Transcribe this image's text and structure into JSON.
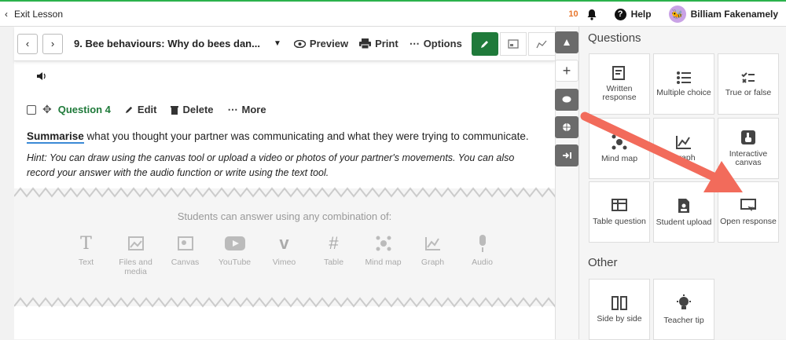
{
  "topbar": {
    "exit_label": "Exit Lesson",
    "notification_count": "10",
    "help_label": "Help",
    "user_name": "Billiam Fakenamely"
  },
  "toolbar": {
    "lesson_title": "9. Bee behaviours: Why do bees dan...",
    "preview_label": "Preview",
    "print_label": "Print",
    "options_label": "Options"
  },
  "question": {
    "label": "Question 4",
    "edit_label": "Edit",
    "delete_label": "Delete",
    "more_label": "More",
    "keyword": "Summarise",
    "text_rest": " what you thought your partner was communicating and what they were trying to communicate.",
    "hint": "Hint: You can draw using the canvas tool or upload a video or photos of your partner's movements. You can also record your answer with the audio function or write using the text tool."
  },
  "answer": {
    "heading": "Students can answer using any combination of:",
    "types": [
      "Text",
      "Files and media",
      "Canvas",
      "YouTube",
      "Vimeo",
      "Table",
      "Mind map",
      "Graph",
      "Audio"
    ]
  },
  "panel": {
    "questions_heading": "Questions",
    "other_heading": "Other",
    "questions": [
      "Written response",
      "Multiple choice",
      "True or false",
      "Mind map",
      "Graph",
      "Interactive canvas",
      "Table question",
      "Student upload",
      "Open response"
    ],
    "other": [
      "Side by side",
      "Teacher tip"
    ]
  },
  "colors": {
    "green": "#1f7a3a",
    "accent_orange": "#e8762c",
    "arrow": "#f26b5b",
    "topline": "#2bb24c"
  }
}
